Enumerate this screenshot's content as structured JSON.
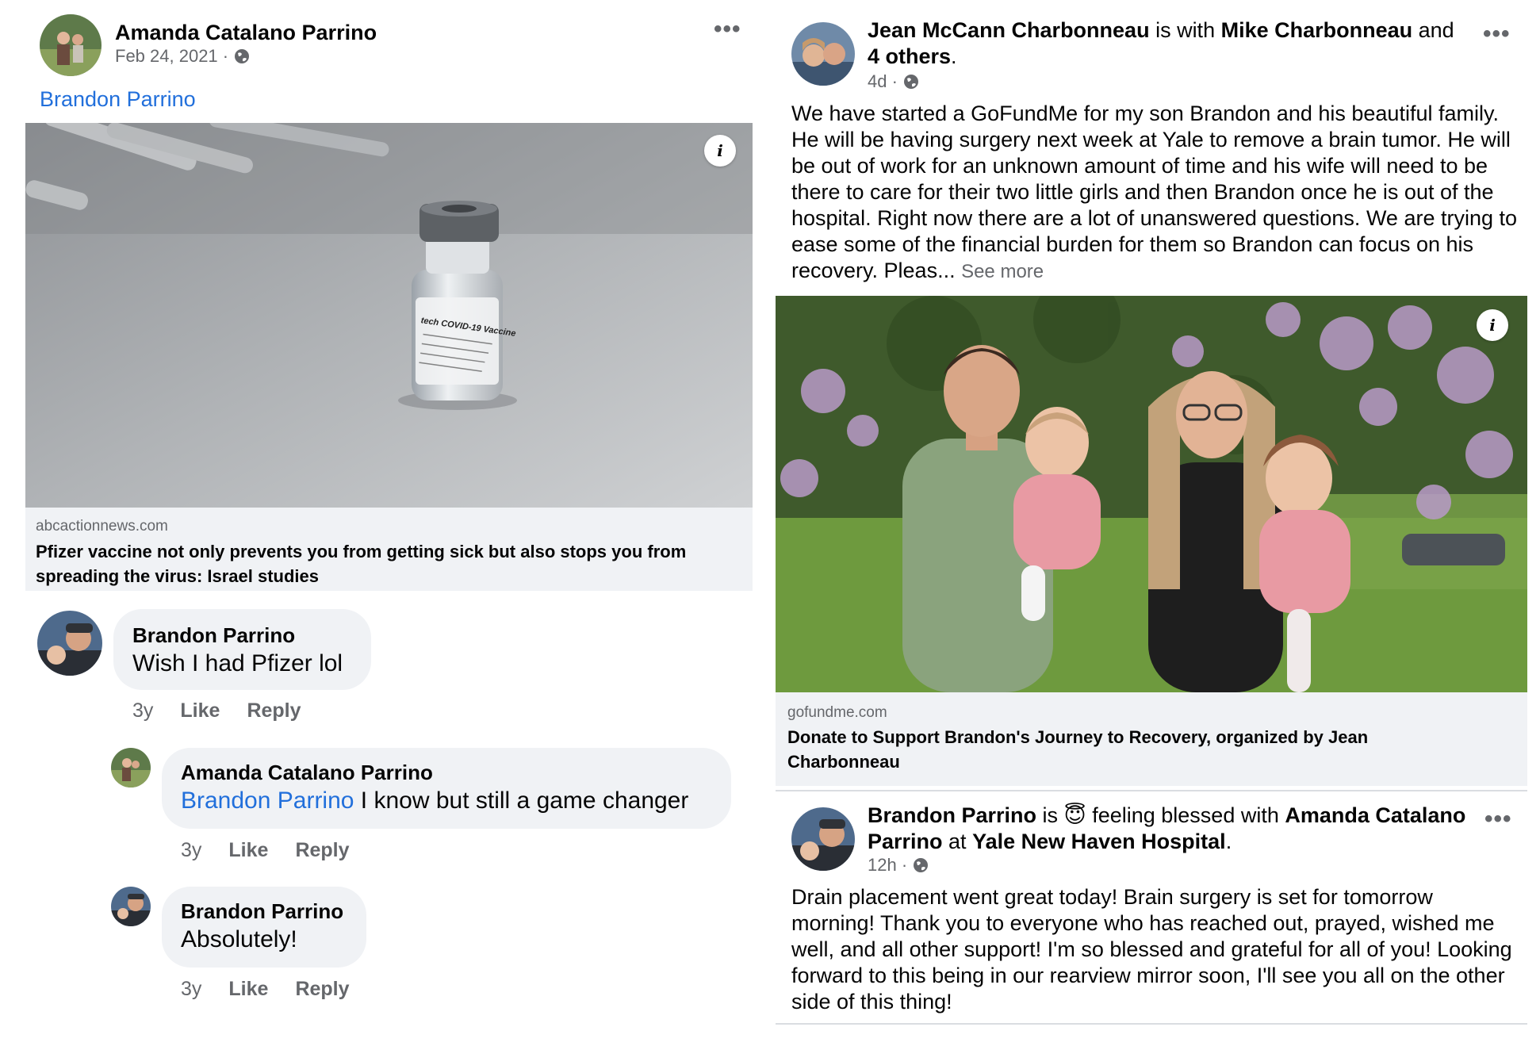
{
  "post1": {
    "author": "Amanda Catalano Parrino",
    "date": "Feb 24, 2021 · ",
    "tag": "Brandon Parrino",
    "link": {
      "domain": "abcactionnews.com",
      "title": "Pfizer vaccine not only prevents you from getting sick but also stops you from spreading the virus: Israel studies"
    },
    "vial_label": "tech COVID-19 Vaccine",
    "comments": [
      {
        "name": "Brandon Parrino",
        "mention": "",
        "text": "Wish I had Pfizer lol",
        "time": "3y",
        "like": "Like",
        "reply": "Reply"
      },
      {
        "name": "Amanda Catalano Parrino",
        "mention": "Brandon Parrino",
        "text": " I know but still a game changer",
        "time": "3y",
        "like": "Like",
        "reply": "Reply"
      },
      {
        "name": "Brandon Parrino",
        "mention": "",
        "text": "Absolutely!",
        "time": "3y",
        "like": "Like",
        "reply": "Reply"
      }
    ]
  },
  "post2": {
    "author": "Jean McCann Charbonneau",
    "is_with": " is with ",
    "with_name": "Mike Charbonneau",
    "and": " and",
    "others": "4 others",
    "period": ".",
    "time": "4d · ",
    "text": "We have started a GoFundMe for my son Brandon and his beautiful family. He will be having surgery next week at Yale to remove a brain tumor. He will be out of work for an unknown amount of time and his wife will need to be there to care for their two little girls and then Brandon once he is out of the hospital. Right now there are a lot of unanswered questions. We are trying to ease some of the financial burden for them so Brandon can focus on his recovery. Pleas... ",
    "see_more": "See more",
    "link": {
      "domain": "gofundme.com",
      "title": "Donate to Support Brandon's Journey to Recovery, organized by Jean Charbonneau"
    }
  },
  "post3": {
    "author": "Brandon Parrino",
    "is": " is ",
    "emoji": "😇",
    "feeling": " feeling blessed with ",
    "with_name": "Amanda Catalano Parrino",
    "at": " at ",
    "place": "Yale New Haven Hospital",
    "period": ".",
    "time": "12h · ",
    "text": "Drain placement went great today! Brain surgery is set for tomorrow morning! Thank you to everyone who has reached out, prayed, wished me well, and all other support! I'm so blessed and grateful for all of you! Looking forward to this being in our rearview mirror soon, I'll see you all on the other side of this thing!"
  },
  "icons": {
    "more": "•••",
    "info": "i",
    "globe": "globe-icon"
  },
  "colors": {
    "link_blue": "#216fdb",
    "meta_gray": "#65676b",
    "bubble_bg": "#f0f2f5"
  }
}
